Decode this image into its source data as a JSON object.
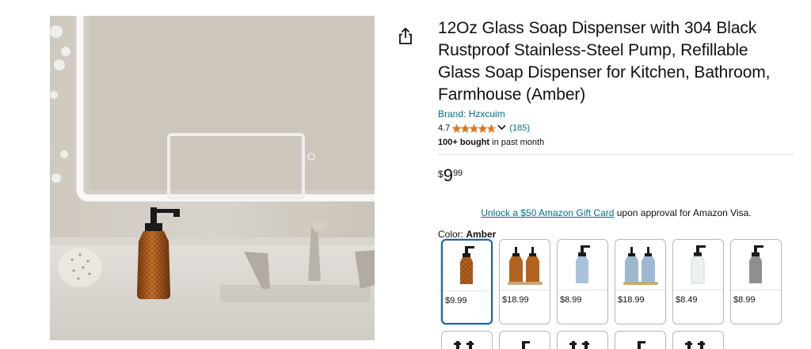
{
  "product": {
    "title": "12Oz Glass Soap Dispenser with 304 Black Rustproof Stainless-Steel Pump, Refillable Glass Soap Dispenser for Kitchen, Bathroom, Farmhouse (Amber)",
    "brand": "Brand: Hzxcuim",
    "rating": "4.7",
    "rating_stars": 4.7,
    "reviews": "(185)",
    "bought_bold": "100+ bought",
    "bought_rest": " in past month",
    "price": {
      "symbol": "$",
      "whole": "9",
      "fraction": "99"
    },
    "promo_link": "Unlock a $50 Amazon Gift Card",
    "promo_rest": " upon approval for Amazon Visa.",
    "color_label": "Color: ",
    "color_value": "Amber"
  },
  "swatches": [
    {
      "price": "$9.99",
      "selected": true,
      "style": "amber-single"
    },
    {
      "price": "$18.99",
      "selected": false,
      "style": "amber-double"
    },
    {
      "price": "$8.99",
      "selected": false,
      "style": "blue-single"
    },
    {
      "price": "$18.99",
      "selected": false,
      "style": "blue-double"
    },
    {
      "price": "$8.49",
      "selected": false,
      "style": "clear-single"
    },
    {
      "price": "$8.99",
      "selected": false,
      "style": "grey-single"
    }
  ],
  "colors": {
    "link": "#007185",
    "star": "#de7921",
    "selected_border": "#2162a1",
    "amber": "#b3621f"
  },
  "icons": {
    "share": "share-icon",
    "star": "star-icon",
    "chevron": "chevron-down-icon"
  }
}
